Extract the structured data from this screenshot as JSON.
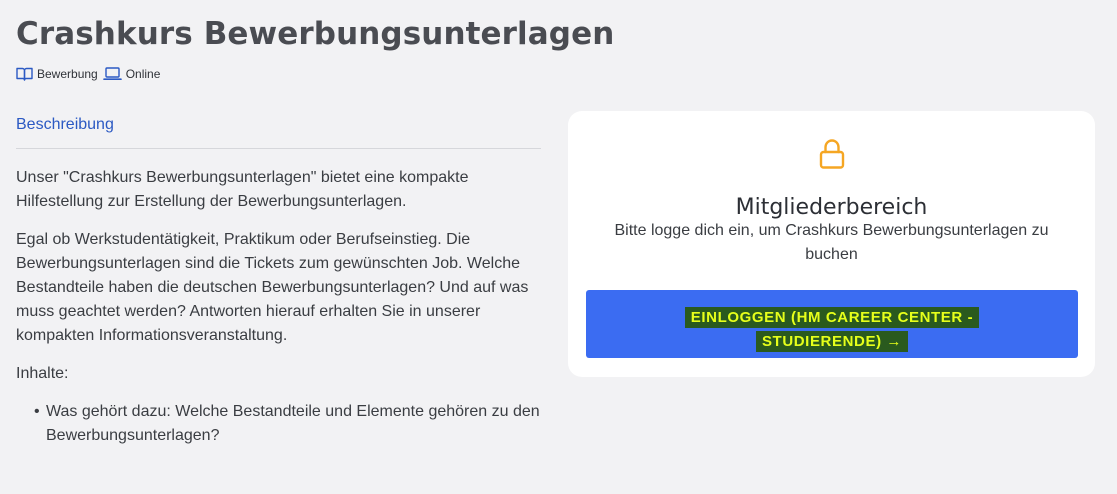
{
  "page": {
    "title": "Crashkurs Bewerbungsunterlagen",
    "meta": [
      {
        "icon": "book-icon",
        "label": "Bewerbung"
      },
      {
        "icon": "laptop-icon",
        "label": "Online"
      }
    ]
  },
  "tabs": [
    {
      "label": "Beschreibung",
      "active": true
    }
  ],
  "description": {
    "paragraphs": [
      "Unser \"Crashkurs Bewerbungsunterlagen\" bietet eine kompakte Hilfestellung zur Erstellung der Bewerbungsunterlagen.",
      "Egal ob Werkstudentätigkeit, Praktikum oder Berufseinstieg. Die Bewerbungsunterlagen sind die Tickets zum gewünschten Job. Welche Bestandteile haben die deutschen Bewerbungsunterlagen? Und auf was muss geachtet werden? Antworten hierauf erhalten Sie in unserer kompakten Informationsveranstaltung.",
      "Inhalte:"
    ],
    "list": [
      "Was gehört dazu: Welche Bestandteile und Elemente gehören zu den Bewerbungsunterlagen?"
    ]
  },
  "members": {
    "icon": "lock-icon",
    "title": "Mitgliederbereich",
    "text": "Bitte logge dich ein, um Crashkurs Bewerbungsunterlagen zu buchen",
    "button_label": "EINLOGGEN (HM CAREER CENTER - STUDIERENDE) →"
  },
  "colors": {
    "accent": "#3b6cf2",
    "lock": "#f5a623",
    "tab_active": "#2b59c3",
    "highlight": "#e6ff1a"
  }
}
